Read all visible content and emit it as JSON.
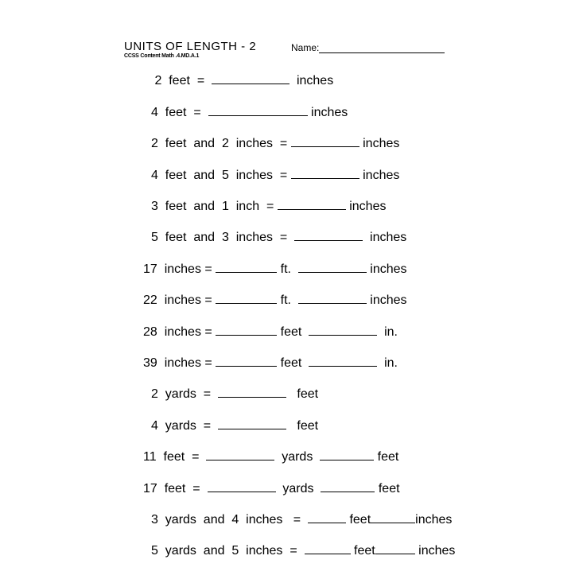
{
  "header": {
    "title": "UNITS  OF  LENGTH - 2",
    "name_label": "Name:",
    "standard": "CCSS Content Math .4.MD.A.1"
  },
  "problems": [
    {
      "parts": [
        " 2  feet  =  ",
        {
          "blank": 1
        },
        "  inches"
      ]
    },
    {
      "parts": [
        "4  feet  =  ",
        {
          "blank": 1
        },
        " inches"
      ]
    },
    {
      "parts": [
        "2  feet  and  2  inches  = ",
        {
          "blank": 1
        },
        " inches"
      ]
    },
    {
      "parts": [
        "4  feet  and  5  inches  = ",
        {
          "blank": 1
        },
        " inches"
      ]
    },
    {
      "parts": [
        "3  feet  and  1  inch  = ",
        {
          "blank": 1
        },
        " inches"
      ]
    },
    {
      "parts": [
        "5  feet  and  3  inches  =  ",
        {
          "blank": 1
        },
        "  inches"
      ]
    },
    {
      "parts": [
        "17  inches = ",
        {
          "blank": 1
        },
        " ft.  ",
        {
          "blank": 2
        },
        " inches"
      ]
    },
    {
      "parts": [
        "22  inches = ",
        {
          "blank": 1
        },
        " ft.  ",
        {
          "blank": 2
        },
        " inches"
      ]
    },
    {
      "parts": [
        "28  inches = ",
        {
          "blank": 1
        },
        " feet  ",
        {
          "blank": 2
        },
        "  in."
      ]
    },
    {
      "parts": [
        "39  inches = ",
        {
          "blank": 1
        },
        " feet  ",
        {
          "blank": 2
        },
        "  in."
      ]
    },
    {
      "parts": [
        "2  yards  =  ",
        {
          "blank": 1
        },
        "   feet"
      ]
    },
    {
      "parts": [
        "4  yards  =  ",
        {
          "blank": 1
        },
        "   feet"
      ]
    },
    {
      "parts": [
        "11  feet  =  ",
        {
          "blank": 1
        },
        "  yards  ",
        {
          "blank": 2
        },
        " feet"
      ]
    },
    {
      "parts": [
        "17  feet  =  ",
        {
          "blank": 1
        },
        "  yards  ",
        {
          "blank": 2
        },
        " feet"
      ]
    },
    {
      "parts": [
        "3  yards  and  4  inches   =  ",
        {
          "blank": 1
        },
        " feet",
        {
          "blank": 2
        },
        "inches"
      ]
    },
    {
      "parts": [
        "5  yards  and  5  inches  =  ",
        {
          "blank": 1
        },
        " feet",
        {
          "blank": 2
        },
        " inches"
      ]
    }
  ]
}
